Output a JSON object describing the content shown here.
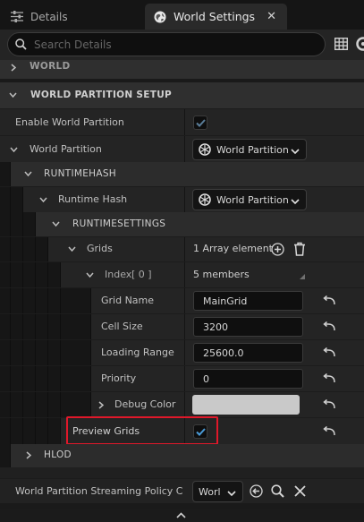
{
  "tabs": {
    "details": {
      "label": "Details"
    },
    "world_settings": {
      "label": "World Settings",
      "close": "✕"
    }
  },
  "search": {
    "placeholder": "Search Details"
  },
  "categories": {
    "world": "WORLD",
    "world_partition_setup": "WORLD PARTITION SETUP",
    "runtimehash": "RUNTIMEHASH",
    "runtimesettings": "RUNTIMESETTINGS",
    "hlod": "HLOD"
  },
  "props": {
    "enable_world_partition": {
      "label": "Enable World Partition",
      "checked": true
    },
    "world_partition": {
      "label": "World Partition",
      "value": "World Partition"
    },
    "runtime_hash": {
      "label": "Runtime Hash",
      "value": "World Partition"
    },
    "grids": {
      "label": "Grids",
      "value": "1 Array element"
    },
    "index": {
      "label": "Index",
      "index": "[ 0 ]",
      "value": "5 members"
    },
    "grid_name": {
      "label": "Grid Name",
      "value": "MainGrid"
    },
    "cell_size": {
      "label": "Cell Size",
      "value": "3200"
    },
    "loading_range": {
      "label": "Loading Range",
      "value": "25600.0"
    },
    "priority": {
      "label": "Priority",
      "value": "0"
    },
    "debug_color": {
      "label": "Debug Color",
      "color": "#c9c9c9"
    },
    "preview_grids": {
      "label": "Preview Grids",
      "checked": true
    },
    "streaming_policy": {
      "label": "World Partition Streaming Policy Clas",
      "value": "Worl"
    }
  },
  "colors": {
    "highlight": "#e0182a",
    "accent_check": "#4a9bd8"
  }
}
